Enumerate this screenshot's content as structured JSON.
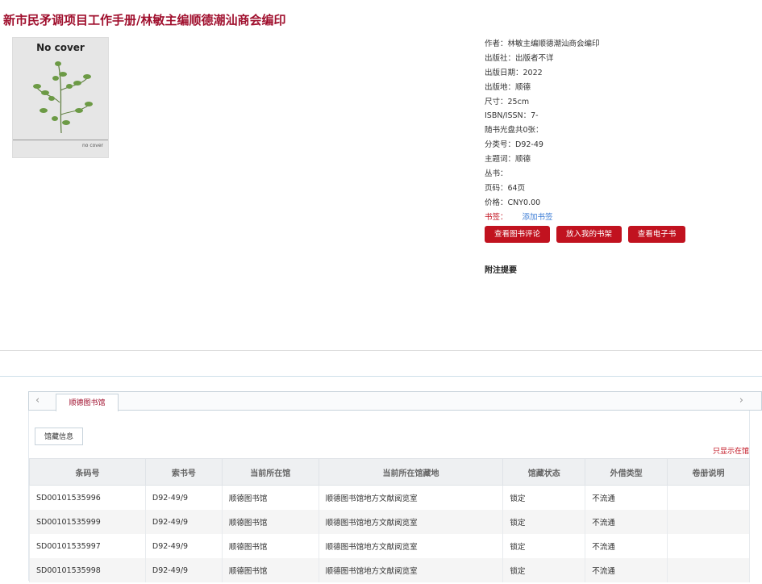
{
  "book": {
    "title": "新市民矛调项目工作手册/林敏主编顺德潮汕商会编印",
    "cover": {
      "text": "No cover",
      "small_text": "no cover"
    },
    "meta": [
      {
        "label": "作者：",
        "value": "林敏主编顺德潮汕商会编印"
      },
      {
        "label": "出版社：",
        "value": "出版者不详"
      },
      {
        "label": "出版日期：",
        "value": "2022"
      },
      {
        "label": "出版地：",
        "value": "顺德"
      },
      {
        "label": "尺寸：",
        "value": "25cm"
      },
      {
        "label": "ISBN/ISSN：",
        "value": "7-"
      },
      {
        "label": "随书光盘共0张：",
        "value": ""
      },
      {
        "label": "分类号：",
        "value": "D92-49"
      },
      {
        "label": "主题词：",
        "value": "顺德"
      },
      {
        "label": "丛书：",
        "value": ""
      },
      {
        "label": "页码：",
        "value": "64页"
      },
      {
        "label": "价格：",
        "value": "CNY0.00"
      }
    ],
    "bookmark": {
      "label": "书签：",
      "link": "添加书签"
    },
    "buttons": {
      "review": "查看图书评论",
      "shelf": "放入我的书架",
      "ebook": "查看电子书"
    },
    "note_title": "附注提要"
  },
  "holdings": {
    "library_tab": "顺德图书馆",
    "sub_tab": "馆藏信息",
    "only_show": "只显示在馆",
    "arrow_left": "‹",
    "arrow_right": "›",
    "columns": [
      "条码号",
      "索书号",
      "当前所在馆",
      "当前所在馆藏地",
      "馆藏状态",
      "外借类型",
      "卷册说明"
    ],
    "rows": [
      [
        "SD00101535996",
        "D92-49/9",
        "顺德图书馆",
        "顺德图书馆地方文献阅览室",
        "锁定",
        "不流通",
        ""
      ],
      [
        "SD00101535999",
        "D92-49/9",
        "顺德图书馆",
        "顺德图书馆地方文献阅览室",
        "锁定",
        "不流通",
        ""
      ],
      [
        "SD00101535997",
        "D92-49/9",
        "顺德图书馆",
        "顺德图书馆地方文献阅览室",
        "锁定",
        "不流通",
        ""
      ],
      [
        "SD00101535998",
        "D92-49/9",
        "顺德图书馆",
        "顺德图书馆地方文献阅览室",
        "锁定",
        "不流通",
        ""
      ]
    ]
  }
}
